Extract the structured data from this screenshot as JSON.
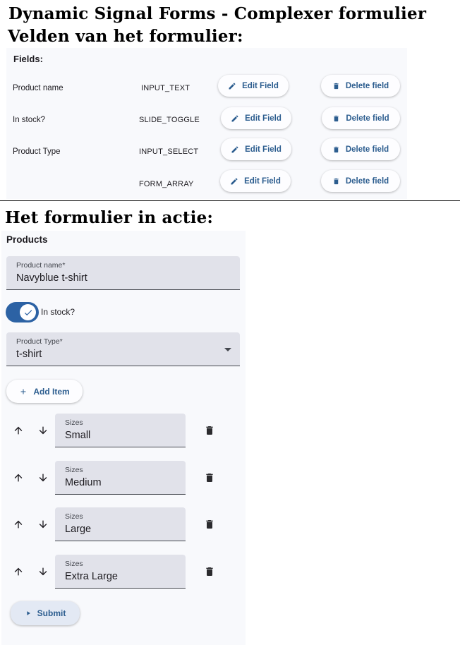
{
  "headings": {
    "title": "Dynamic Signal Forms - Complexer formulier",
    "fields_heading": "Velden van het formulier:",
    "form_heading": "Het formulier in actie:"
  },
  "fields_panel": {
    "title": "Fields:",
    "rows": [
      {
        "name": "Product name",
        "type": "INPUT_TEXT",
        "edit_label": "Edit Field",
        "delete_label": "Delete field"
      },
      {
        "name": "In stock?",
        "type": "SLIDE_TOGGLE",
        "edit_label": "Edit Field",
        "delete_label": "Delete field"
      },
      {
        "name": "Product Type",
        "type": "INPUT_SELECT",
        "edit_label": "Edit Field",
        "delete_label": "Delete field"
      },
      {
        "name": "",
        "type": "FORM_ARRAY",
        "edit_label": "Edit Field",
        "delete_label": "Delete field"
      }
    ]
  },
  "form": {
    "title": "Products",
    "product_name": {
      "label": "Product name*",
      "value": "Navyblue t-shirt"
    },
    "in_stock": {
      "label": "In stock?",
      "checked": true
    },
    "product_type": {
      "label": "Product Type*",
      "value": "t-shirt"
    },
    "add_item_label": "Add Item",
    "sizes": [
      {
        "label": "Sizes",
        "value": "Small"
      },
      {
        "label": "Sizes",
        "value": "Medium"
      },
      {
        "label": "Sizes",
        "value": "Large"
      },
      {
        "label": "Sizes",
        "value": "Extra Large"
      }
    ],
    "submit_label": "Submit"
  },
  "colors": {
    "accent": "#2c62a4",
    "button_text": "#2c5d8f",
    "field_bg": "#e1e2ea"
  }
}
